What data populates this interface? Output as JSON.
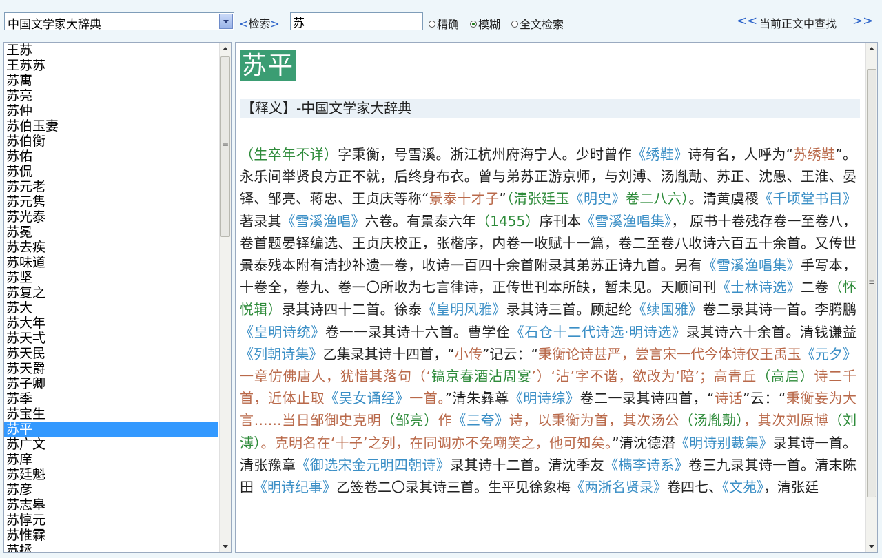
{
  "toolbar": {
    "dictionary_selected": "中国文学家大辞典",
    "search_label_left": "<",
    "search_label_text": "检索",
    "search_label_right": ">",
    "search_value": "苏",
    "radio_exact": "精确",
    "radio_fuzzy": "模糊",
    "radio_fulltext": "全文检索",
    "selected_radio": "模糊",
    "nav_prev": "<<",
    "find_label": "当前正文中查找",
    "nav_next": ">>"
  },
  "list": {
    "selected": "苏平",
    "items": [
      "王苏",
      "王苏苏",
      "苏寓",
      "苏亮",
      "苏仲",
      "苏伯玉妻",
      "苏伯衡",
      "苏佑",
      "苏侃",
      "苏元老",
      "苏元隽",
      "苏光泰",
      "苏冕",
      "苏去疾",
      "苏味道",
      "苏坚",
      "苏复之",
      "苏大",
      "苏大年",
      "苏天弌",
      "苏天民",
      "苏天爵",
      "苏子卿",
      "苏季",
      "苏宝生",
      "苏平",
      "苏广文",
      "苏庠",
      "苏廷魁",
      "苏彦",
      "苏志皋",
      "苏惇元",
      "苏惟霖",
      "苏拯"
    ]
  },
  "entry": {
    "headword": "苏平",
    "definition_header": "【释义】-中国文学家大辞典",
    "segments": [
      {
        "c": "g",
        "t": "（生卒年不详）"
      },
      {
        "c": "k",
        "t": "字秉衡，号雪溪。浙江杭州府海宁人。少时曾作"
      },
      {
        "c": "b",
        "t": "《绣鞋》"
      },
      {
        "c": "k",
        "t": "诗有名，人呼为“"
      },
      {
        "c": "o",
        "t": "苏绣鞋"
      },
      {
        "c": "k",
        "t": "”。永乐间举贤良方正不就，后终身布衣。曾与弟苏正游京师，与刘溥、汤胤勣、苏正、沈愚、王淮、晏铎、邹亮、蒋忠、王贞庆等称“"
      },
      {
        "c": "o",
        "t": "景泰十才子"
      },
      {
        "c": "k",
        "t": "”"
      },
      {
        "c": "g",
        "t": "（清张廷玉"
      },
      {
        "c": "b",
        "t": "《明史》"
      },
      {
        "c": "g",
        "t": "卷二八六）"
      },
      {
        "c": "k",
        "t": "。清黄虞稷"
      },
      {
        "c": "b",
        "t": "《千顷堂书目》"
      },
      {
        "c": "k",
        "t": "著录其"
      },
      {
        "c": "b",
        "t": "《雪溪渔唱》"
      },
      {
        "c": "k",
        "t": "六卷。有景泰六年"
      },
      {
        "c": "g",
        "t": "（1455）"
      },
      {
        "c": "k",
        "t": "序刊本"
      },
      {
        "c": "b",
        "t": "《雪溪渔唱集》"
      },
      {
        "c": "k",
        "t": "， 原书十卷残存卷一至卷八，卷首题晏铎编选、王贞庆校正，张楷序，内卷一收赋十一篇，卷二至卷八收诗六百五十余首。又传世景泰残本附有清抄补遗一卷，收诗一百四十余首附录其弟苏正诗九首。另有"
      },
      {
        "c": "b",
        "t": "《雪溪渔唱集》"
      },
      {
        "c": "k",
        "t": "手写本，十卷全，卷九、卷一〇所收为七言律诗，正传世刊本所缺，暂未见。天顺间刊"
      },
      {
        "c": "b",
        "t": "《士林诗选》"
      },
      {
        "c": "k",
        "t": "二卷"
      },
      {
        "c": "g",
        "t": "（怀悦辑）"
      },
      {
        "c": "k",
        "t": "录其诗四十二首。徐泰"
      },
      {
        "c": "b",
        "t": "《皇明风雅》"
      },
      {
        "c": "k",
        "t": "录其诗三首。顾起纶"
      },
      {
        "c": "b",
        "t": "《续国雅》"
      },
      {
        "c": "k",
        "t": "卷二录其诗一首。李腾鹏"
      },
      {
        "c": "b",
        "t": "《皇明诗统》"
      },
      {
        "c": "k",
        "t": "卷一一录其诗十六首。曹学佺"
      },
      {
        "c": "b",
        "t": "《石仓十二代诗选·明诗选》"
      },
      {
        "c": "k",
        "t": "录其诗六十余首。清钱谦益"
      },
      {
        "c": "b",
        "t": "《列朝诗集》"
      },
      {
        "c": "k",
        "t": "乙集录其诗十四首，“"
      },
      {
        "c": "o",
        "t": "小传"
      },
      {
        "c": "k",
        "t": "”记云：“"
      },
      {
        "c": "o",
        "t": "秉衡论诗甚严，尝言宋一代今体诗仅王禹玉"
      },
      {
        "c": "b",
        "t": "《元夕》"
      },
      {
        "c": "o",
        "t": "一章仿佛唐人，犹惜其落句（‘"
      },
      {
        "c": "g",
        "t": "镐京春酒沾周宴"
      },
      {
        "c": "o",
        "t": "’）‘沾’字不谐，欲改为‘陪’；高青丘"
      },
      {
        "c": "g",
        "t": "（高启）"
      },
      {
        "c": "o",
        "t": "诗二千首，近体止取"
      },
      {
        "c": "b",
        "t": "《吴女诵经》"
      },
      {
        "c": "o",
        "t": "一首。"
      },
      {
        "c": "k",
        "t": "”清朱彝尊"
      },
      {
        "c": "b",
        "t": "《明诗综》"
      },
      {
        "c": "k",
        "t": "卷二一录其诗四首，“"
      },
      {
        "c": "o",
        "t": "诗话"
      },
      {
        "c": "k",
        "t": "”云：“"
      },
      {
        "c": "o",
        "t": "秉衡妄为大言……当日邹御史克明"
      },
      {
        "c": "g",
        "t": "（邹亮）"
      },
      {
        "c": "o",
        "t": "作"
      },
      {
        "c": "b",
        "t": "《三夸》"
      },
      {
        "c": "o",
        "t": "诗，以秉衡为首，其次汤公"
      },
      {
        "c": "g",
        "t": "（汤胤勣）"
      },
      {
        "c": "o",
        "t": "，其次刘原博"
      },
      {
        "c": "g",
        "t": "（刘溥）"
      },
      {
        "c": "o",
        "t": "。克明名在‘十子’之列，在同调亦不免嘲笑之，他可知矣。"
      },
      {
        "c": "k",
        "t": "”清沈德潜"
      },
      {
        "c": "b",
        "t": "《明诗别裁集》"
      },
      {
        "c": "k",
        "t": "录其诗一首。清张豫章"
      },
      {
        "c": "b",
        "t": "《御选宋金元明四朝诗》"
      },
      {
        "c": "k",
        "t": "录其诗十二首。清沈季友"
      },
      {
        "c": "b",
        "t": "《檇李诗系》"
      },
      {
        "c": "k",
        "t": "卷三九录其诗一首。清末陈田"
      },
      {
        "c": "b",
        "t": "《明诗纪事》"
      },
      {
        "c": "k",
        "t": "乙签卷二〇录其诗三首。生平见徐象梅"
      },
      {
        "c": "b",
        "t": "《两浙名贤录》"
      },
      {
        "c": "k",
        "t": "卷四七、"
      },
      {
        "c": "b",
        "t": "《文苑》"
      },
      {
        "c": "k",
        "t": "，清张廷"
      }
    ]
  }
}
